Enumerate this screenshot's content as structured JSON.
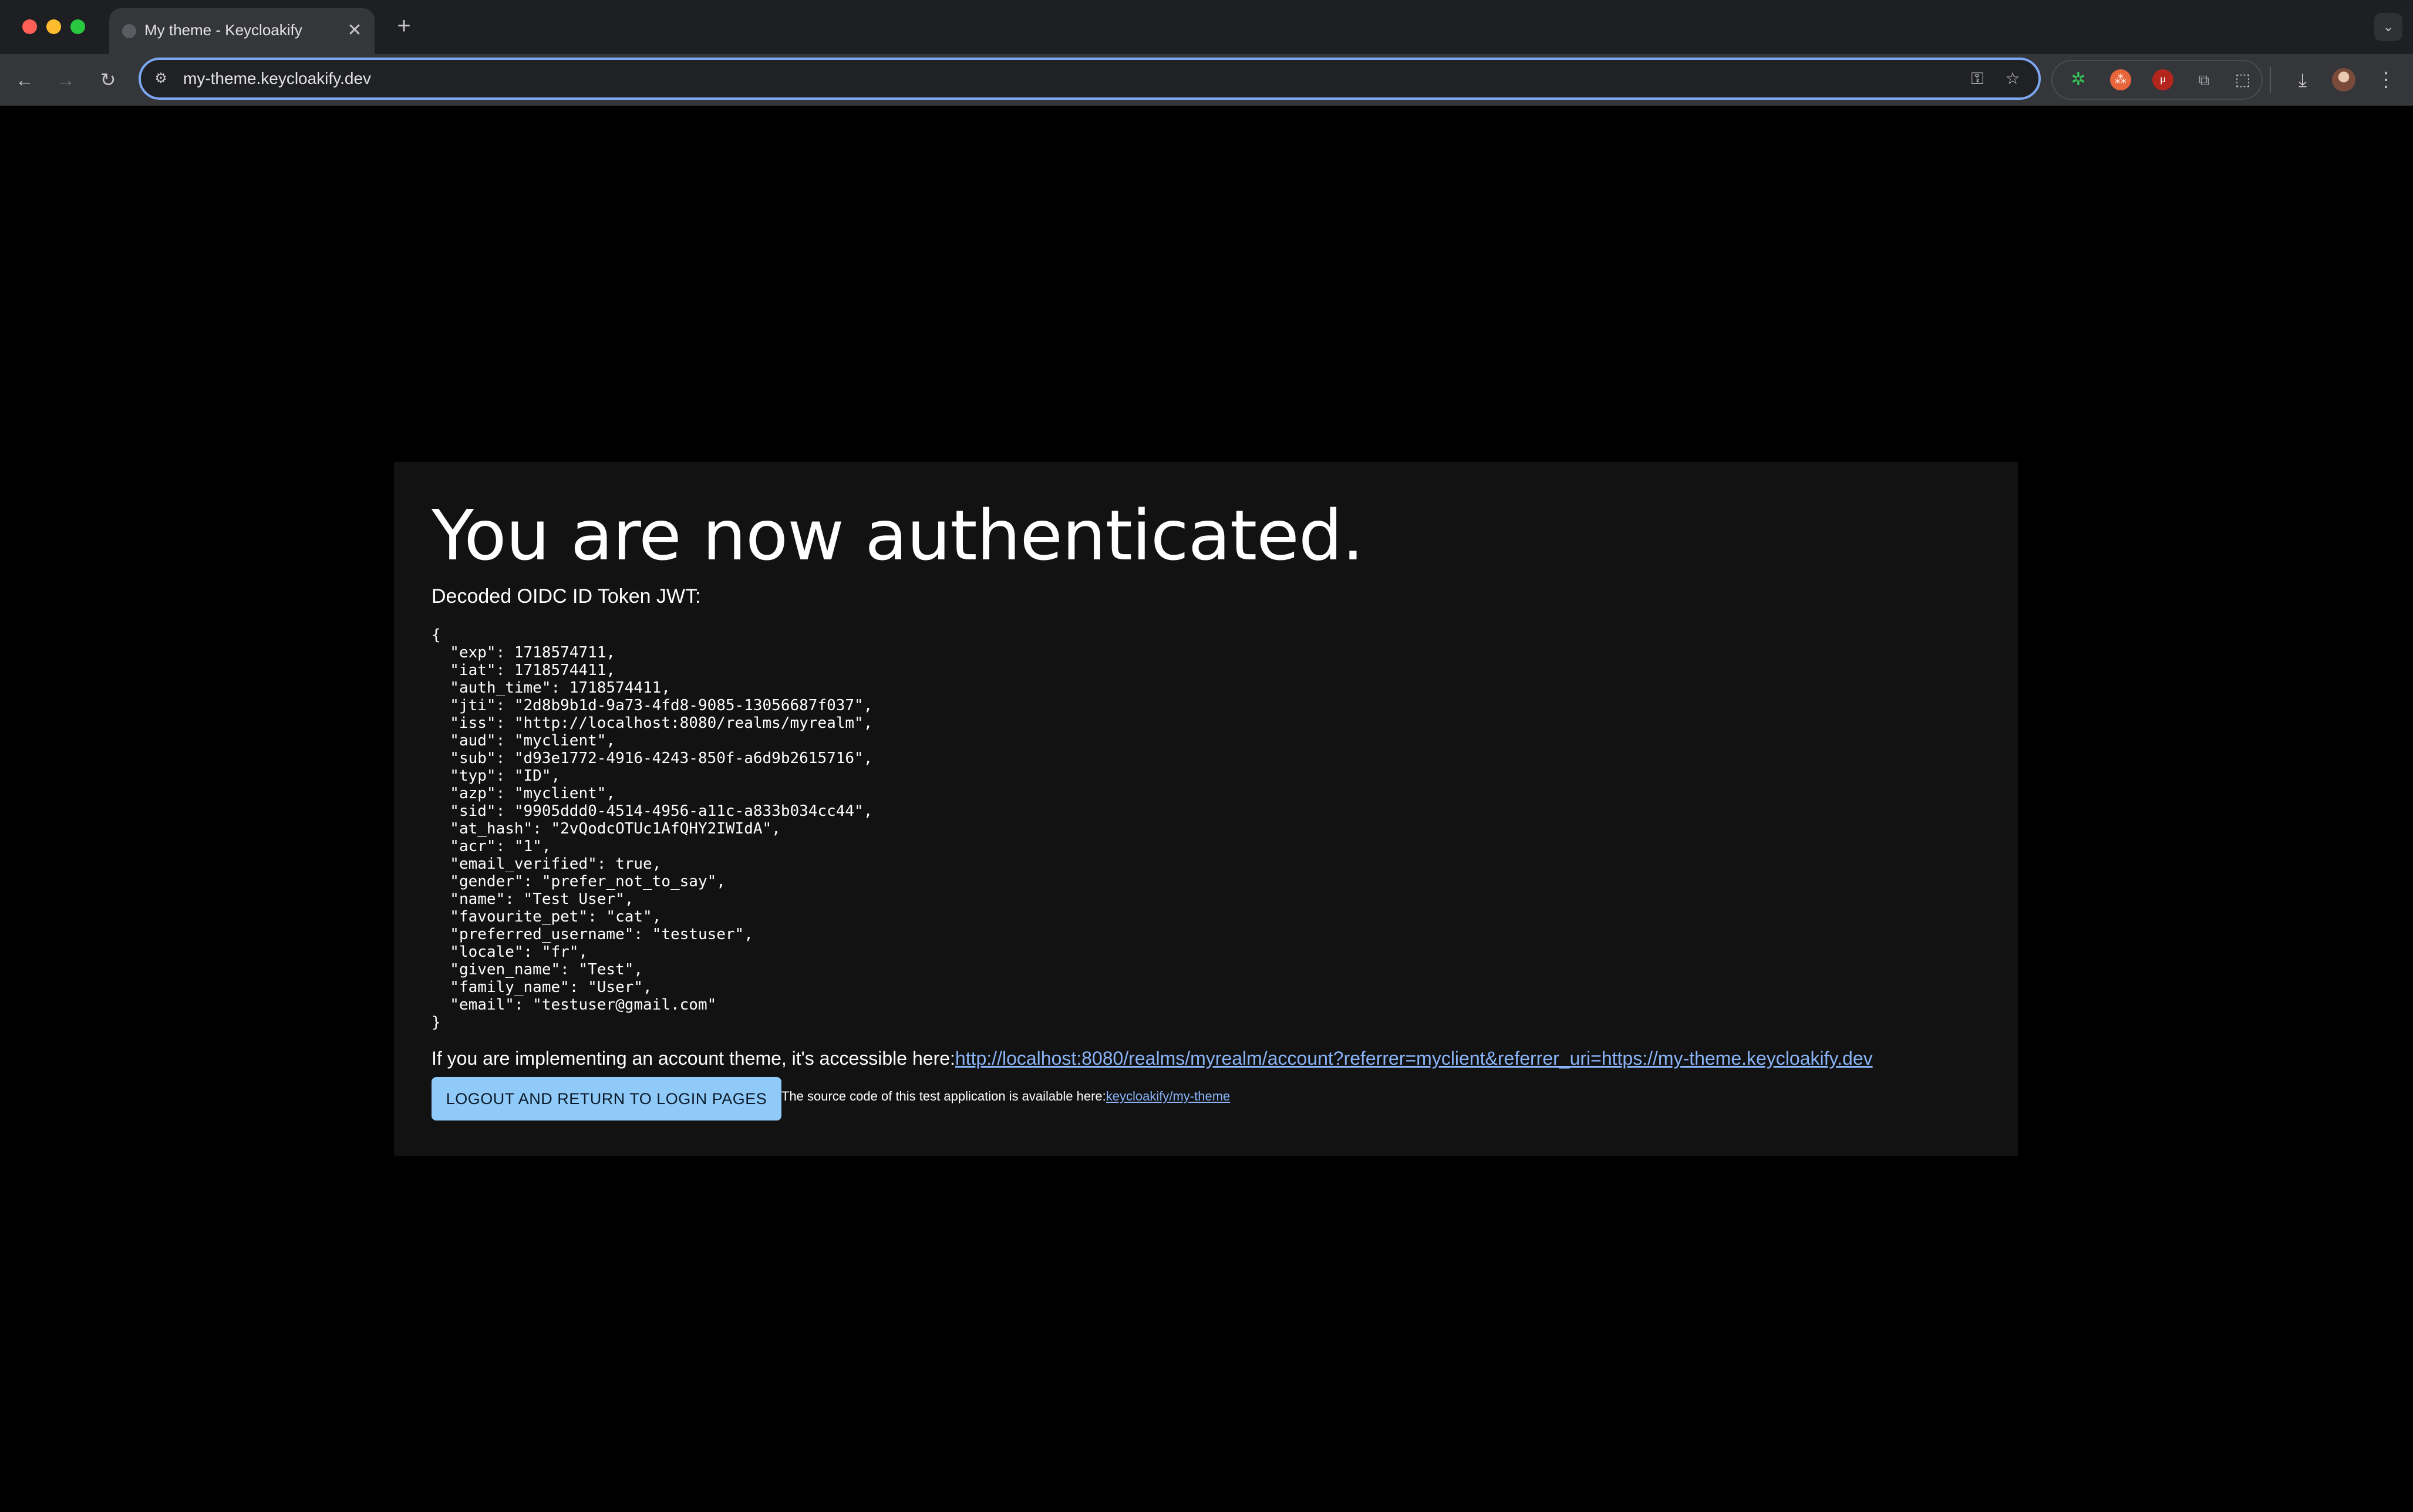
{
  "browser": {
    "tab_title": "My theme - Keycloakify",
    "tab_close_glyph": "✕",
    "new_tab_glyph": "+",
    "tab_menu_glyph": "⌄",
    "url": "my-theme.keycloakify.dev",
    "nav": {
      "back_glyph": "←",
      "forward_glyph": "→",
      "reload_glyph": "↻"
    },
    "icons": {
      "site_info": "⚙",
      "key": "⚿",
      "star": "☆",
      "download": "⤓",
      "menu": "⋮"
    },
    "extensions": [
      {
        "name": "green-extension-icon",
        "glyph": "✲"
      },
      {
        "name": "orange-extension-icon",
        "glyph": "⁂"
      },
      {
        "name": "ublock-extension-icon",
        "glyph": "μ"
      },
      {
        "name": "code-extension-icon",
        "glyph": "⧉"
      },
      {
        "name": "extensions-puzzle-icon",
        "glyph": "⬚"
      }
    ]
  },
  "page": {
    "heading": "You are now authenticated.",
    "subheading": "Decoded OIDC ID Token JWT:",
    "jwt_json": "{\n  \"exp\": 1718574711,\n  \"iat\": 1718574411,\n  \"auth_time\": 1718574411,\n  \"jti\": \"2d8b9b1d-9a73-4fd8-9085-13056687f037\",\n  \"iss\": \"http://localhost:8080/realms/myrealm\",\n  \"aud\": \"myclient\",\n  \"sub\": \"d93e1772-4916-4243-850f-a6d9b2615716\",\n  \"typ\": \"ID\",\n  \"azp\": \"myclient\",\n  \"sid\": \"9905ddd0-4514-4956-a11c-a833b034cc44\",\n  \"at_hash\": \"2vQodcOTUc1AfQHY2IWIdA\",\n  \"acr\": \"1\",\n  \"email_verified\": true,\n  \"gender\": \"prefer_not_to_say\",\n  \"name\": \"Test User\",\n  \"favourite_pet\": \"cat\",\n  \"preferred_username\": \"testuser\",\n  \"locale\": \"fr\",\n  \"given_name\": \"Test\",\n  \"family_name\": \"User\",\n  \"email\": \"testuser@gmail.com\"\n}",
    "account_text": "If you are implementing an account theme, it's accessible here:",
    "account_link": "http://localhost:8080/realms/myrealm/account?referrer=myclient&referrer_uri=https://my-theme.keycloakify.dev",
    "logout_label": "LOGOUT AND RETURN TO LOGIN PAGES",
    "source_text": "The source code of this test application is available here:",
    "source_link": "keycloakify/my-theme"
  },
  "colors": {
    "page_background": "#000000",
    "card_background": "#121212",
    "button_background": "#90caf9",
    "link": "#8ab4f8",
    "omnibox_focus_ring": "#7ca6f0"
  }
}
